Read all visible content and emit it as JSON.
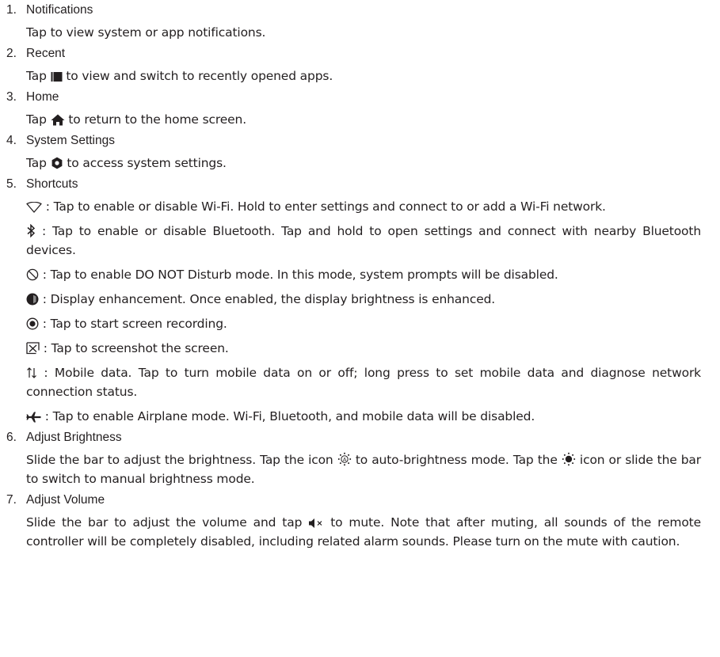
{
  "items": [
    {
      "num": "1.",
      "title": "Notifications",
      "text": "Tap to view system or app notifications."
    },
    {
      "num": "2.",
      "title": "Recent",
      "pre": "Tap ",
      "icon": "recent-apps-icon",
      "post": " to view and switch to recently opened apps."
    },
    {
      "num": "3.",
      "title": "Home",
      "pre": "Tap ",
      "icon": "home-icon",
      "post": " to return to the home screen."
    },
    {
      "num": "4.",
      "title": "System Settings",
      "pre": "Tap ",
      "icon": "settings-gear-icon",
      "post": " to access system settings."
    },
    {
      "num": "5.",
      "title": "Shortcuts",
      "shortcuts": [
        {
          "icon": "wifi-icon",
          "text": " : Tap to enable or disable Wi-Fi. Hold to enter settings and connect to or add a Wi-Fi network."
        },
        {
          "icon": "bluetooth-icon",
          "text": " : Tap to enable or disable Bluetooth. Tap and hold to open settings and connect with nearby Bluetooth devices."
        },
        {
          "icon": "do-not-disturb-icon",
          "text": " : Tap to enable DO NOT Disturb mode. In this mode, system prompts will be disabled."
        },
        {
          "icon": "display-enhancement-icon",
          "text": " : Display enhancement. Once enabled, the display brightness is enhanced."
        },
        {
          "icon": "screen-record-icon",
          "text": " : Tap to start screen recording."
        },
        {
          "icon": "screenshot-icon",
          "text": " : Tap to screenshot the screen."
        },
        {
          "icon": "mobile-data-icon",
          "text": " : Mobile data. Tap to turn mobile data on or off; long press to set mobile data and diagnose network connection status."
        },
        {
          "icon": "airplane-mode-icon",
          "text": " : Tap to enable Airplane mode. Wi-Fi, Bluetooth, and mobile data will be disabled."
        }
      ]
    },
    {
      "num": "6.",
      "title": "Adjust Brightness",
      "part1": "Slide the bar to adjust the brightness. Tap the icon ",
      "icon1": "auto-brightness-icon",
      "part2": " to auto-brightness mode. Tap the ",
      "icon2": "manual-brightness-icon",
      "part3": " icon or slide the bar to switch to manual brightness mode."
    },
    {
      "num": "7.",
      "title": "Adjust Volume",
      "part1": "Slide the bar to adjust the volume and tap ",
      "icon1": "mute-icon",
      "part2": " to mute. Note that after muting, all sounds of the remote controller will be completely disabled, including related alarm sounds. Please turn on the mute with caution."
    }
  ]
}
